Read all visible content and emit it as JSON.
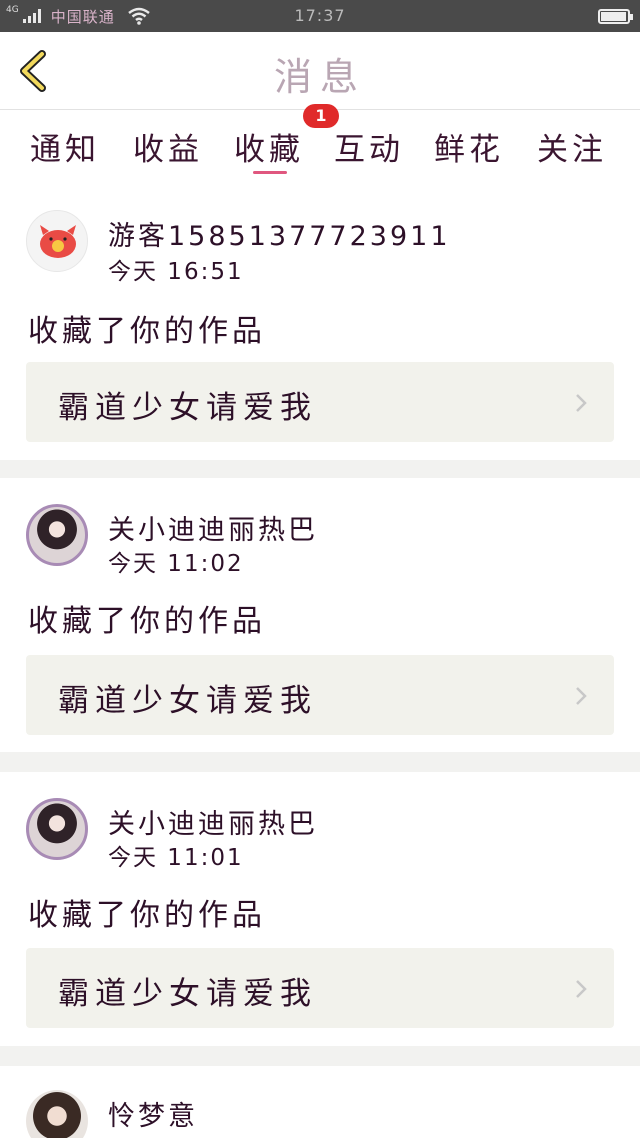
{
  "status_bar": {
    "network": "4G",
    "carrier": "中国联通",
    "time": "17:37",
    "battery_level": 0.88,
    "icons": [
      "signal-icon",
      "wifi-icon",
      "battery-icon"
    ]
  },
  "header": {
    "title": "消息",
    "back_icon": "chevron-left-icon"
  },
  "tabs": {
    "items": [
      {
        "label": "通知"
      },
      {
        "label": "收益"
      },
      {
        "label": "收藏"
      },
      {
        "label": "互动"
      },
      {
        "label": "鲜花"
      },
      {
        "label": "关注"
      }
    ],
    "active_index": 2,
    "badge": "1"
  },
  "messages": [
    {
      "name": "游客15851377723911",
      "time": "今天 16:51",
      "action": "收藏了你的作品",
      "work": "霸道少女请爱我",
      "avatar": "guest-avatar-icon"
    },
    {
      "name": "关小迪迪丽热巴",
      "time": "今天 11:02",
      "action": "收藏了你的作品",
      "work": "霸道少女请爱我",
      "avatar": "user-photo-avatar"
    },
    {
      "name": "关小迪迪丽热巴",
      "time": "今天 11:01",
      "action": "收藏了你的作品",
      "work": "霸道少女请爱我",
      "avatar": "user-photo-avatar"
    },
    {
      "name": "怜梦意",
      "time": "",
      "action": "",
      "work": "",
      "avatar": "user-photo-avatar"
    }
  ],
  "colors": {
    "accent": "#e0577f",
    "badge": "#e02a2a",
    "text": "#2d1028",
    "work_box_bg": "#f2f2ec"
  }
}
